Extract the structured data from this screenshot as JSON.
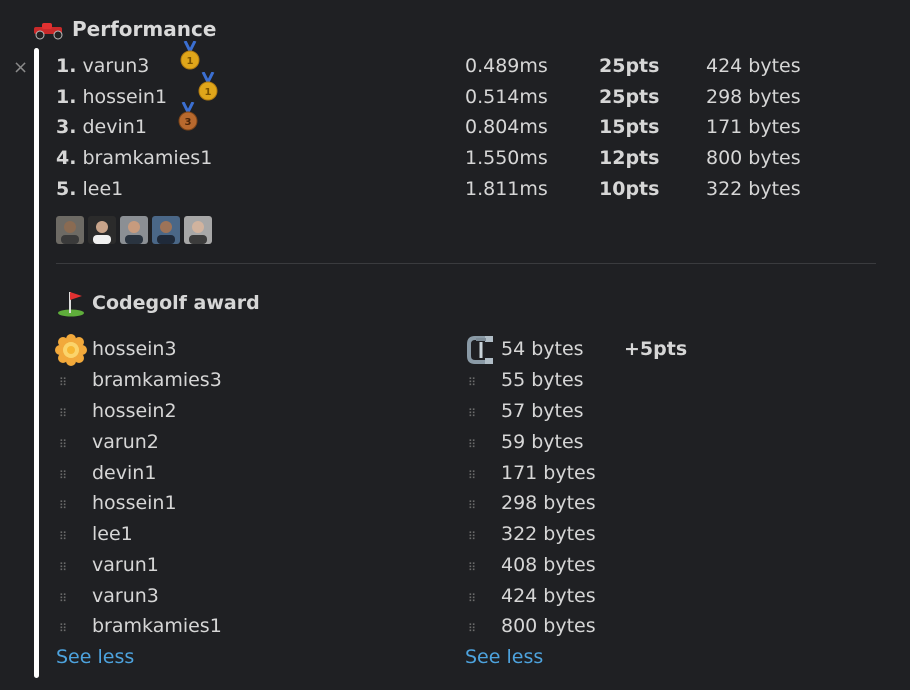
{
  "section": {
    "icon": "race-car-icon",
    "title": "Performance",
    "close_label": "×"
  },
  "leaderboard": [
    {
      "rank": "1.",
      "name": "varun3",
      "time": "0.489ms",
      "pts": "25pts",
      "bytes": "424 bytes",
      "medal": "gold-medal-icon"
    },
    {
      "rank": "1.",
      "name": "hossein1",
      "time": "0.514ms",
      "pts": "25pts",
      "bytes": "298 bytes",
      "medal": "gold-medal-icon"
    },
    {
      "rank": "3.",
      "name": "devin1",
      "time": "0.804ms",
      "pts": "15pts",
      "bytes": "171 bytes",
      "medal": "bronze-medal-icon"
    },
    {
      "rank": "4.",
      "name": "bramkamies1",
      "time": "1.550ms",
      "pts": "12pts",
      "bytes": "800 bytes",
      "medal": ""
    },
    {
      "rank": "5.",
      "name": "lee1",
      "time": "1.811ms",
      "pts": "10pts",
      "bytes": "322 bytes",
      "medal": ""
    }
  ],
  "avatars": [
    "avatar-1",
    "avatar-2",
    "avatar-3",
    "avatar-4",
    "avatar-5"
  ],
  "codegolf": {
    "icon": "golf-flag-icon",
    "title": "Codegolf award",
    "winner_icon": "rosette-icon",
    "clamp_icon": "clamp-icon",
    "bonus": "+5pts",
    "names": [
      "hossein3",
      "bramkamies3",
      "hossein2",
      "varun2",
      "devin1",
      "hossein1",
      "lee1",
      "varun1",
      "varun3",
      "bramkamies1"
    ],
    "bytes": [
      "54 bytes",
      "55 bytes",
      "57 bytes",
      "59 bytes",
      "171 bytes",
      "298 bytes",
      "322 bytes",
      "408 bytes",
      "424 bytes",
      "800 bytes"
    ],
    "see_less_left": "See less",
    "see_less_right": "See less"
  },
  "colors": {
    "link": "#4da3de",
    "gold": "#e0a61a",
    "bronze": "#b8692e"
  }
}
